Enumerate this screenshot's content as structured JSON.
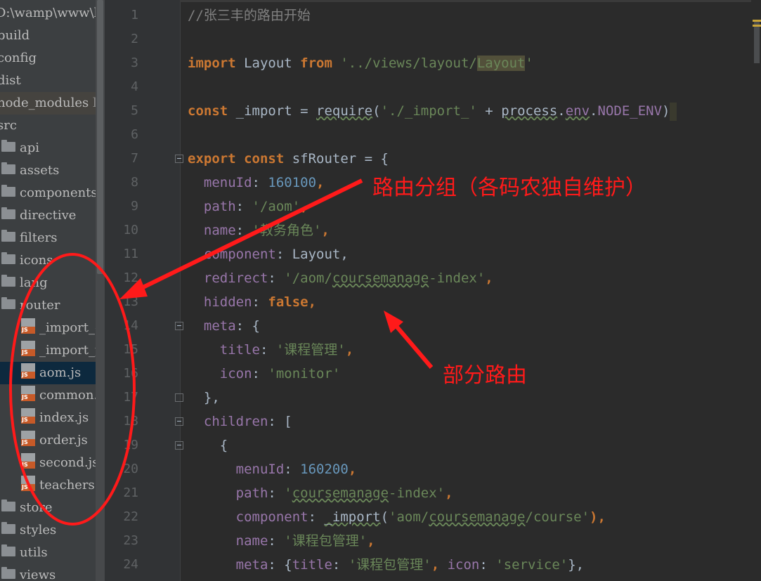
{
  "project_tree": {
    "items": [
      {
        "type": "root",
        "label": "D:\\wamp\\www\\k"
      },
      {
        "type": "folder",
        "label": "build"
      },
      {
        "type": "folder",
        "label": "config"
      },
      {
        "type": "folder",
        "label": "dist"
      },
      {
        "type": "folder",
        "label": "node_modules",
        "tag": "lib"
      },
      {
        "type": "folder",
        "label": "src"
      },
      {
        "type": "folder",
        "label": "api"
      },
      {
        "type": "folder",
        "label": "assets"
      },
      {
        "type": "folder",
        "label": "components"
      },
      {
        "type": "folder",
        "label": "directive"
      },
      {
        "type": "folder",
        "label": "filters"
      },
      {
        "type": "folder",
        "label": "icons"
      },
      {
        "type": "folder",
        "label": "lang"
      },
      {
        "type": "folder",
        "label": "router"
      },
      {
        "type": "file",
        "label": "_import_de"
      },
      {
        "type": "file",
        "label": "_import_pr"
      },
      {
        "type": "file",
        "label": "aom.js"
      },
      {
        "type": "file",
        "label": "common.js"
      },
      {
        "type": "file",
        "label": "index.js"
      },
      {
        "type": "file",
        "label": "order.js"
      },
      {
        "type": "file",
        "label": "second.js"
      },
      {
        "type": "file",
        "label": "teachers.js"
      },
      {
        "type": "folder",
        "label": "store"
      },
      {
        "type": "folder",
        "label": "styles"
      },
      {
        "type": "folder",
        "label": "utils"
      },
      {
        "type": "folder",
        "label": "views"
      }
    ],
    "js_badge": "JS"
  },
  "editor": {
    "line_numbers": [
      "1",
      "2",
      "3",
      "4",
      "5",
      "6",
      "7",
      "8",
      "9",
      "10",
      "11",
      "12",
      "13",
      "14",
      "15",
      "16",
      "17",
      "18",
      "19",
      "20",
      "21",
      "22",
      "23",
      "24"
    ],
    "code": {
      "l1": "//张三丰的路由开始",
      "l3_import": "import",
      "l3_name": " Layout ",
      "l3_from": "from",
      "l3_str_a": " '../views/layout/",
      "l3_str_hl": "Layout",
      "l3_str_b": "'",
      "l5_const": "const",
      "l5_a": " _import = ",
      "l5_require": "require",
      "l5_b": "(",
      "l5_str": "'./_import_'",
      "l5_c": " + ",
      "l5_process": "process",
      "l5_d": ".",
      "l5_env": "env",
      "l5_e": ".",
      "l5_node": "NODE_ENV",
      "l5_f": ")",
      "l7_export": "export",
      "l7_const": " const",
      "l7_rest": " sfRouter = {",
      "l8_key": "  menuId",
      "l8_colon": ": ",
      "l8_val": "160100",
      "l8_end": ",",
      "l9_key": "  path",
      "l9_colon": ": ",
      "l9_val": "'/aom'",
      "l9_end": ",",
      "l10_key": "  name",
      "l10_colon": ": ",
      "l10_val": "'教务角色'",
      "l10_end": ",",
      "l11_key": "  component",
      "l11_rest": ": Layout,",
      "l12_key": "  redirect",
      "l12_colon": ": ",
      "l12_val_a": "'/aom/",
      "l12_val_u": "coursemanage",
      "l12_val_b": "-index'",
      "l12_end": ",",
      "l13_key": "  hidden",
      "l13_colon": ": ",
      "l13_val": "false",
      "l13_end": ",",
      "l14_key": "  meta",
      "l14_rest": ": {",
      "l15_key": "    title",
      "l15_colon": ": ",
      "l15_val": "'课程管理'",
      "l15_end": ",",
      "l16_key": "    icon",
      "l16_colon": ": ",
      "l16_val": "'monitor'",
      "l17": "  },",
      "l18_key": "  children",
      "l18_rest": ": [",
      "l19": "    {",
      "l20_key": "      menuId",
      "l20_colon": ": ",
      "l20_val": "160200",
      "l20_end": ",",
      "l21_key": "      path",
      "l21_colon": ": ",
      "l21_val_a": "'",
      "l21_val_u": "coursemanage",
      "l21_val_b": "-index'",
      "l21_end": ",",
      "l22_key": "      component",
      "l22_colon": ": ",
      "l22_fn": "_import",
      "l22_p": "(",
      "l22_val_a": "'aom/",
      "l22_val_u": "coursemanage",
      "l22_val_b": "/course'",
      "l22_end": "),",
      "l23_key": "      name",
      "l23_colon": ": ",
      "l23_val": "'课程包管理'",
      "l23_end": ",",
      "l24_key": "      meta",
      "l24_a": ": {",
      "l24_title": "title",
      "l24_b": ": ",
      "l24_tval": "'课程包管理'",
      "l24_c": ", ",
      "l24_icon": "icon",
      "l24_d": ": ",
      "l24_ival": "'service'",
      "l24_e": "},"
    }
  },
  "annotations": {
    "route_group": "路由分组（各码农独自维护）",
    "partial_route": "部分路由",
    "color": "#ff1a1a"
  }
}
